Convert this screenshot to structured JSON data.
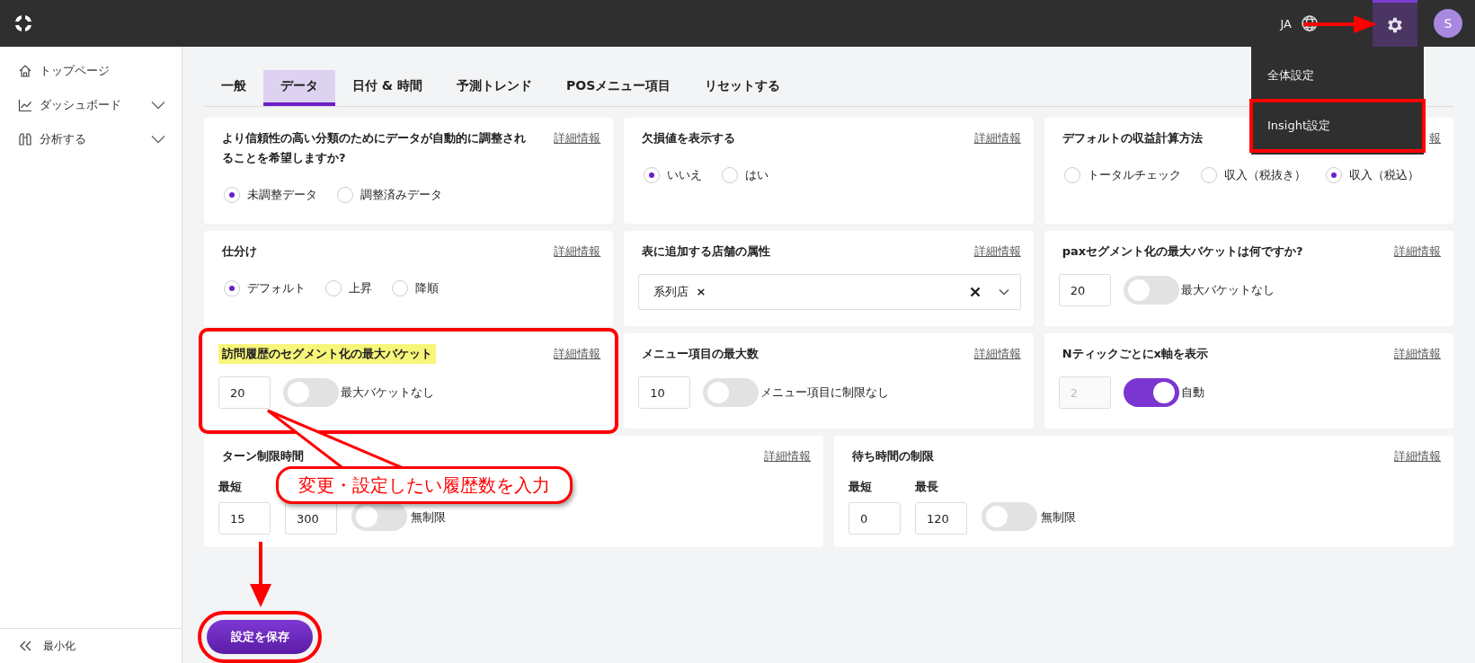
{
  "topbar": {
    "language": "JA",
    "avatar": "S",
    "settings_open": true
  },
  "settings_menu": [
    {
      "label": "全体設定",
      "annotated": false
    },
    {
      "label": "Insight設定",
      "annotated": true
    }
  ],
  "sidebar": {
    "items": [
      {
        "label": "トップページ",
        "expandable": false
      },
      {
        "label": "ダッシュボード",
        "expandable": true
      },
      {
        "label": "分析する",
        "expandable": true
      }
    ],
    "collapse": "最小化"
  },
  "tabs": [
    {
      "label": "一般",
      "selected": false
    },
    {
      "label": "データ",
      "selected": true
    },
    {
      "label": "日付 & 時間",
      "selected": false
    },
    {
      "label": "予測トレンド",
      "selected": false
    },
    {
      "label": "POSメニュー項目",
      "selected": false
    },
    {
      "label": "リセットする",
      "selected": false
    }
  ],
  "card_rows": [
    [
      {
        "kind": "radio",
        "title": "より信頼性の高い分類のためにデータが自動的に調整されることを希望しますか?",
        "info": "詳細情報",
        "options": [
          {
            "label": "未調整データ",
            "selected": true
          },
          {
            "label": "調整済みデータ",
            "selected": false
          }
        ]
      },
      {
        "kind": "radio",
        "title": "欠損値を表示する",
        "info": "詳細情報",
        "options": [
          {
            "label": "いいえ",
            "selected": true
          },
          {
            "label": "はい",
            "selected": false
          }
        ]
      },
      {
        "kind": "radio",
        "title": "デフォルトの収益計算方法",
        "info": "報",
        "options": [
          {
            "label": "トータルチェック",
            "selected": false
          },
          {
            "label": "収入（税抜き）",
            "selected": false
          },
          {
            "label": "収入（税込）",
            "selected": true
          }
        ]
      }
    ],
    [
      {
        "kind": "radio",
        "title": "仕分け",
        "info": "詳細情報",
        "options": [
          {
            "label": "デフォルト",
            "selected": true
          },
          {
            "label": "上昇",
            "selected": false
          },
          {
            "label": "降順",
            "selected": false
          }
        ]
      },
      {
        "kind": "multiselect",
        "title": "表に追加する店舗の属性",
        "info": "詳細情報",
        "tags": [
          {
            "label": "系列店",
            "remove": "×"
          }
        ]
      },
      {
        "kind": "number_toggle",
        "title": "paxセグメント化の最大バケットは何ですか?",
        "info": "詳細情報",
        "value": "20",
        "input_disabled": false,
        "toggle_on": false,
        "toggle_label": "最大バケットなし"
      }
    ],
    [
      {
        "kind": "number_toggle",
        "title": "訪問履歴のセグメント化の最大バケット",
        "info": "詳細情報",
        "value": "20",
        "input_disabled": false,
        "toggle_on": false,
        "toggle_label": "最大バケットなし",
        "annotated": true,
        "title_highlighted": true
      },
      {
        "kind": "number_toggle",
        "title": "メニュー項目の最大数",
        "info": "詳細情報",
        "value": "10",
        "input_disabled": false,
        "toggle_on": false,
        "toggle_label": "メニュー項目に制限なし"
      },
      {
        "kind": "number_toggle",
        "title": "Nティックごとにx軸を表示",
        "info": "詳細情報",
        "value": "2",
        "input_disabled": true,
        "toggle_on": true,
        "toggle_label": "自動"
      }
    ],
    [
      {
        "kind": "range",
        "title": "ターン制限時間",
        "info": "詳細情報",
        "fields": [
          {
            "label": "最短",
            "value": "15"
          },
          {
            "value": "300"
          }
        ],
        "toggle_on": false,
        "toggle_label": "無制限"
      },
      {
        "kind": "range",
        "title": "待ち時間の制限",
        "info": "詳細情報",
        "fields": [
          {
            "label": "最短",
            "value": "0"
          },
          {
            "label": "最長",
            "value": "120"
          }
        ],
        "toggle_on": false,
        "toggle_label": "無制限"
      }
    ]
  ],
  "save_button": {
    "label": "設定を保存",
    "annotated": true
  },
  "annotations": {
    "callout": "変更・設定したい履歴数を入力"
  }
}
